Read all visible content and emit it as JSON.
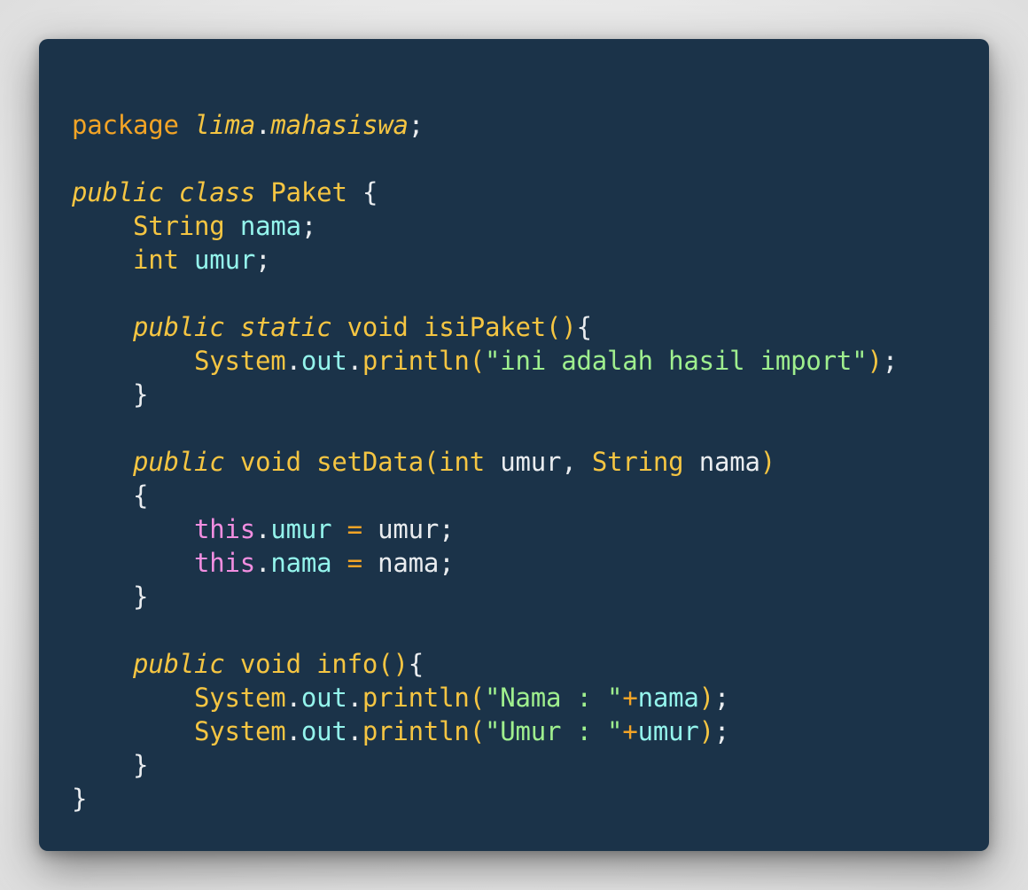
{
  "code": {
    "line1": {
      "kw": "package",
      "pkg_a": "lima",
      "dot": ".",
      "pkg_b": "mahasiswa",
      "semi": ";"
    },
    "line3": {
      "mod1": "public",
      "mod2": "class",
      "name": "Paket",
      "brace": "{"
    },
    "line4": {
      "type": "String",
      "field": "nama",
      "semi": ";"
    },
    "line5": {
      "type": "int",
      "field": "umur",
      "semi": ";"
    },
    "line7": {
      "mod1": "public",
      "mod2": "static",
      "ret": "void",
      "fn": "isiPaket",
      "paren": "()",
      "brace": "{"
    },
    "line8": {
      "obj": "System",
      "dot1": ".",
      "field": "out",
      "dot2": ".",
      "fn": "println",
      "open": "(",
      "str": "\"ini adalah hasil import\"",
      "close": ")",
      "semi": ";"
    },
    "line9": {
      "brace": "}"
    },
    "line11": {
      "mod": "public",
      "ret": "void",
      "fn": "setData",
      "open": "(",
      "t1": "int",
      "p1": "umur",
      "comma": ",",
      "t2": "String",
      "p2": "nama",
      "close": ")"
    },
    "line12": {
      "brace": "{"
    },
    "line13": {
      "this": "this",
      "dot": ".",
      "field": "umur",
      "op": "=",
      "val": "umur",
      "semi": ";"
    },
    "line14": {
      "this": "this",
      "dot": ".",
      "field": "nama",
      "op": "=",
      "val": "nama",
      "semi": ";"
    },
    "line15": {
      "brace": "}"
    },
    "line17": {
      "mod": "public",
      "ret": "void",
      "fn": "info",
      "paren": "()",
      "brace": "{"
    },
    "line18": {
      "obj": "System",
      "dot1": ".",
      "field": "out",
      "dot2": ".",
      "fn": "println",
      "open": "(",
      "str": "\"Nama : \"",
      "op": "+",
      "var": "nama",
      "close": ")",
      "semi": ";"
    },
    "line19": {
      "obj": "System",
      "dot1": ".",
      "field": "out",
      "dot2": ".",
      "fn": "println",
      "open": "(",
      "str": "\"Umur : \"",
      "op": "+",
      "var": "umur",
      "close": ")",
      "semi": ";"
    },
    "line20": {
      "brace": "}"
    },
    "line21": {
      "brace": "}"
    }
  },
  "colors": {
    "background": "#1b3349",
    "keyword": "#f3a426",
    "type": "#f5c542",
    "field": "#94f4ec",
    "this": "#f18ee0",
    "string": "#9fef8e",
    "plain": "#e9ecef"
  }
}
